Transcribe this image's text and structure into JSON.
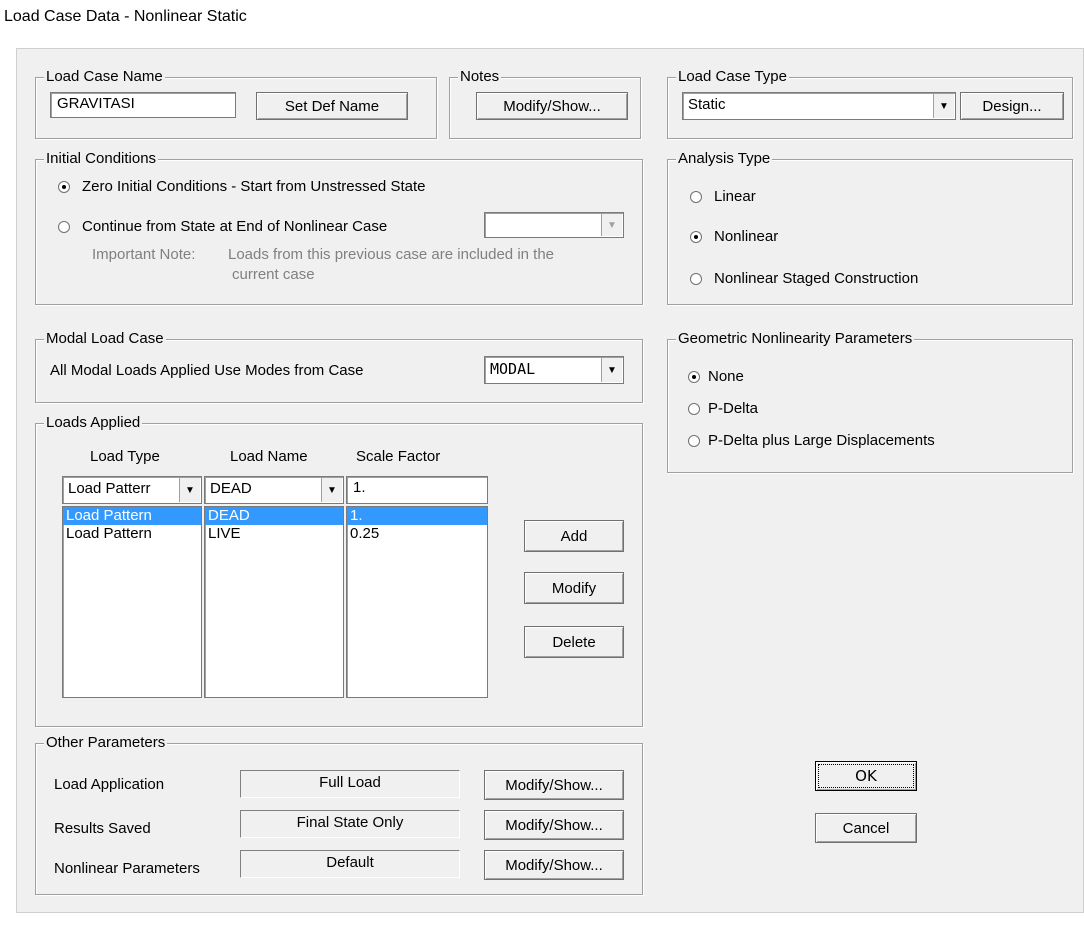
{
  "window_title": "Load Case Data - Nonlinear Static",
  "load_case_name": {
    "legend": "Load Case Name",
    "value": "GRAVITASI",
    "set_def_name_button": "Set Def Name"
  },
  "notes": {
    "legend": "Notes",
    "modify_show_button": "Modify/Show..."
  },
  "load_case_type": {
    "legend": "Load Case Type",
    "selected": "Static",
    "design_button": "Design..."
  },
  "initial_conditions": {
    "legend": "Initial Conditions",
    "zero_option": "Zero Initial Conditions - Start from Unstressed State",
    "continue_option": "Continue from State at End of Nonlinear Case",
    "important_note_label": "Important Note:",
    "important_note_line1": "Loads from this previous case are included in the",
    "important_note_line2": "current case",
    "continue_case_selected": ""
  },
  "analysis_type": {
    "legend": "Analysis Type",
    "options": [
      "Linear",
      "Nonlinear",
      "Nonlinear Staged Construction"
    ],
    "selected": "Nonlinear"
  },
  "modal_load_case": {
    "legend": "Modal Load Case",
    "label": "All Modal Loads Applied Use Modes from Case",
    "selected": "MODAL"
  },
  "geometric_nonlinearity": {
    "legend": "Geometric Nonlinearity Parameters",
    "options": [
      "None",
      "P-Delta",
      "P-Delta plus Large Displacements"
    ],
    "selected": "None"
  },
  "loads_applied": {
    "legend": "Loads Applied",
    "headers": [
      "Load Type",
      "Load Name",
      "Scale Factor"
    ],
    "edit_row": {
      "load_type": "Load Patterr",
      "load_name": "DEAD",
      "scale_factor": "1."
    },
    "rows": [
      {
        "load_type": "Load Pattern",
        "load_name": "DEAD",
        "scale_factor": "1."
      },
      {
        "load_type": "Load Pattern",
        "load_name": "LIVE",
        "scale_factor": "0.25"
      }
    ],
    "selected_row": 0,
    "add_button": "Add",
    "modify_button": "Modify",
    "delete_button": "Delete"
  },
  "other_parameters": {
    "legend": "Other Parameters",
    "items": [
      {
        "label": "Load Application",
        "value": "Full Load",
        "button": "Modify/Show..."
      },
      {
        "label": "Results Saved",
        "value": "Final State Only",
        "button": "Modify/Show..."
      },
      {
        "label": "Nonlinear Parameters",
        "value": "Default",
        "button": "Modify/Show..."
      }
    ]
  },
  "ok_button": "OK",
  "cancel_button": "Cancel"
}
